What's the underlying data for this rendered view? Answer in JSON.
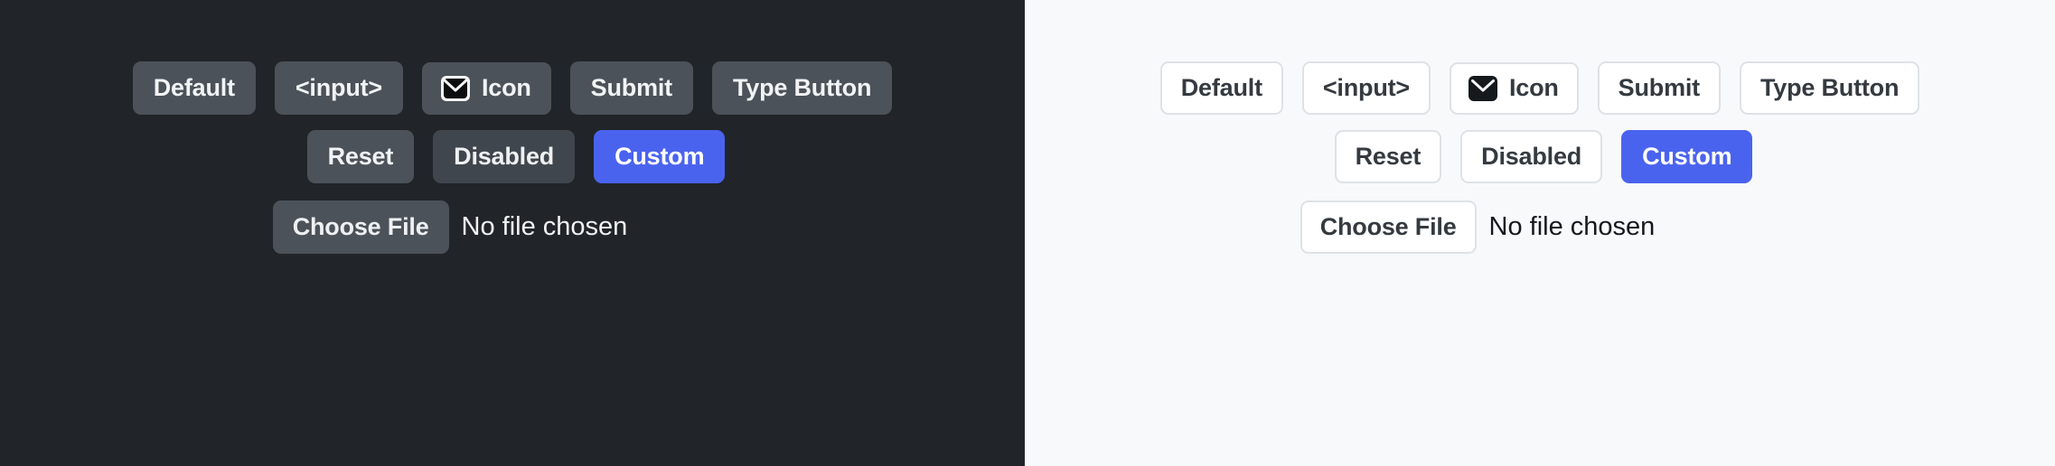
{
  "meta": {
    "accent_color": "#4a63ef",
    "dark_background": "#212529",
    "light_background": "#f8f9fb",
    "dark_button_background": "#4b5259",
    "dark_button_text": "#f1f3f5",
    "light_button_background": "#ffffff",
    "light_button_border": "#dee2e6",
    "light_button_text": "#343a40"
  },
  "panels": {
    "dark": {
      "row1": [
        {
          "label": "Default",
          "name": "default-button"
        },
        {
          "label": "<input>",
          "name": "input-button"
        },
        {
          "label": "Icon",
          "name": "icon-button",
          "icon": "envelope-icon"
        },
        {
          "label": "Submit",
          "name": "submit-button"
        },
        {
          "label": "Type Button",
          "name": "type-button"
        }
      ],
      "row2": [
        {
          "label": "Reset",
          "name": "reset-button"
        },
        {
          "label": "Disabled",
          "name": "disabled-button"
        },
        {
          "label": "Custom",
          "name": "custom-button"
        }
      ],
      "file": {
        "button_label": "Choose File",
        "status": "No file chosen"
      }
    },
    "light": {
      "row1": [
        {
          "label": "Default",
          "name": "default-button"
        },
        {
          "label": "<input>",
          "name": "input-button"
        },
        {
          "label": "Icon",
          "name": "icon-button",
          "icon": "envelope-icon"
        },
        {
          "label": "Submit",
          "name": "submit-button"
        },
        {
          "label": "Type Button",
          "name": "type-button"
        }
      ],
      "row2": [
        {
          "label": "Reset",
          "name": "reset-button"
        },
        {
          "label": "Disabled",
          "name": "disabled-button"
        },
        {
          "label": "Custom",
          "name": "custom-button"
        }
      ],
      "file": {
        "button_label": "Choose File",
        "status": "No file chosen"
      }
    }
  }
}
